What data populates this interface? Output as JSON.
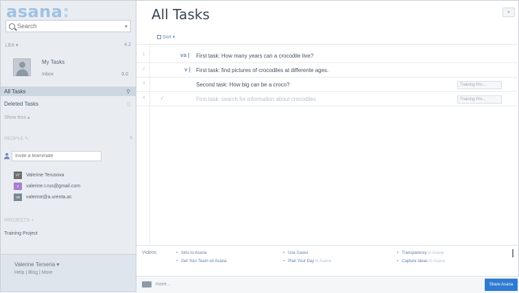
{
  "brand": {
    "logo_text": "asana"
  },
  "sidebar": {
    "search_placeholder": "Search",
    "workspace_label": "LEX ▾",
    "workspace_count": "4.2",
    "my_tasks": {
      "title": "My Tasks",
      "inbox": "Inbox",
      "count": "0.0"
    },
    "nav": [
      {
        "label": "All Tasks",
        "icon": "search-icon"
      },
      {
        "label": "Deleted Tasks",
        "icon": "trash-icon"
      }
    ],
    "show_more": "Show less ▴",
    "people_header": "PEOPLE",
    "people_edit": "✎",
    "people_count": "8",
    "invite_placeholder": "Invite a teammate",
    "people": [
      {
        "initials": "VT",
        "name": "Valerine Terusova",
        "color": "#6d6d6d"
      },
      {
        "initials": "v",
        "name": "valerine.t.rus@gmail.com",
        "color": "#a77fd0"
      },
      {
        "initials": "va",
        "name": "valerine@a.urenta.ac",
        "color": "#7b8794"
      }
    ],
    "projects_header": "PROJECTS",
    "projects_add": "+",
    "projects": [
      {
        "label": "Training Project"
      }
    ],
    "footer": {
      "user": "Valerine Terseria ▾",
      "links": "Help | Blog | More"
    }
  },
  "main": {
    "title": "All Tasks",
    "close_label": "×",
    "sort_label": "Sort ▾",
    "tasks": [
      {
        "num": "1",
        "assignee": "va |",
        "name": "First task: How many years can a crocodile live?",
        "tag": "",
        "done": false
      },
      {
        "num": "2",
        "assignee": "v |",
        "name": "First task: find pictures of crocodiles at differente ages.",
        "tag": "",
        "done": false
      },
      {
        "num": "3",
        "assignee": "",
        "name": "Second task: How big can be a croco?",
        "tag": "Training Pro...",
        "done": false
      },
      {
        "num": "4",
        "assignee": "",
        "name": "First task: search for information about crocodiles",
        "tag": "Training Pro...",
        "done": true
      }
    ],
    "videos": {
      "label": "Videos",
      "items": [
        {
          "bullet": "•",
          "text": "Intro to Asana",
          "suffix": ""
        },
        {
          "bullet": "•",
          "text": "Get Your Team on Asana",
          "suffix": ""
        },
        {
          "bullet": "•",
          "text": "Use Cases",
          "suffix": ""
        },
        {
          "bullet": "•",
          "text": "Plan Your Day",
          "suffix": "in Asana"
        },
        {
          "bullet": "•",
          "text": "Transparency",
          "suffix": "in Asana"
        },
        {
          "bullet": "•",
          "text": "Capture Ideas",
          "suffix": "in Asana"
        }
      ]
    },
    "footer": {
      "more_label": "more...",
      "share_label": "Share Asana"
    }
  }
}
